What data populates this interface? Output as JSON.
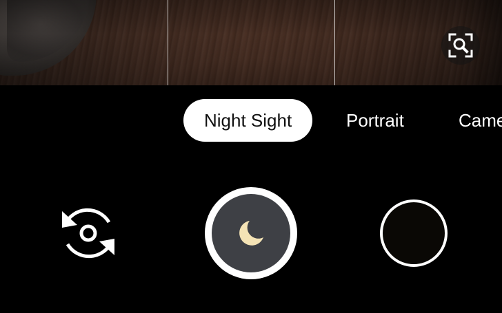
{
  "viewfinder": {
    "grid_lines": 2,
    "zoom_icon": "zoom-search-icon"
  },
  "modes": {
    "items": [
      {
        "label": "Night Sight",
        "active": true
      },
      {
        "label": "Portrait",
        "active": false
      },
      {
        "label": "Came",
        "active": false
      }
    ]
  },
  "controls": {
    "switch_camera_icon": "switch-camera-icon",
    "shutter_icon": "moon-icon",
    "gallery_thumbnail_icon": "gallery-thumbnail"
  },
  "colors": {
    "background": "#000000",
    "active_mode_bg": "#ffffff",
    "shutter_inner": "#3e4045",
    "moon": "#f4e3b5"
  }
}
